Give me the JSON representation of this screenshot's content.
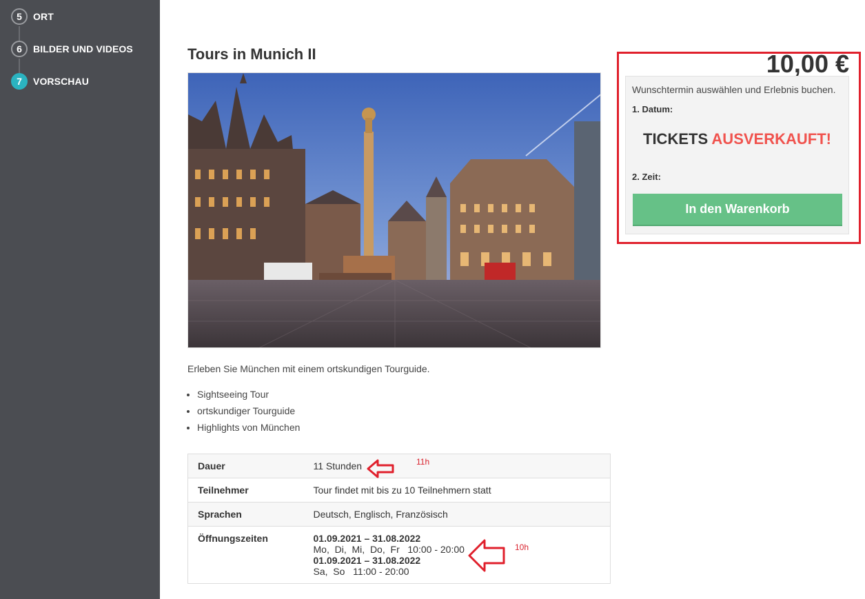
{
  "sidebar": {
    "steps": [
      {
        "number": "5",
        "label": "ORT",
        "active": false
      },
      {
        "number": "6",
        "label": "BILDER UND VIDEOS",
        "active": false
      },
      {
        "number": "7",
        "label": "VORSCHAU",
        "active": true
      }
    ]
  },
  "main": {
    "title": "Tours in Munich II",
    "description": "Erleben Sie München mit einem ortskundigen Tourguide.",
    "highlights": [
      "Sightseeing Tour",
      "ortskundiger Tourguide",
      "Highlights von München"
    ],
    "details": {
      "duration_label": "Dauer",
      "duration_value": "11 Stunden",
      "participants_label": "Teilnehmer",
      "participants_value": "Tour findet mit bis zu 10 Teilnehmern statt",
      "languages_label": "Sprachen",
      "languages_value": "Deutsch, Englisch, Französisch",
      "hours_label": "Öffnungszeiten",
      "hours": [
        {
          "range": "01.09.2021 – 31.08.2022",
          "days": "Mo,  Di,  Mi,  Do,  Fr   10:00 - 20:00"
        },
        {
          "range": "01.09.2021 – 31.08.2022",
          "days": "Sa,  So   11:00 - 20:00"
        }
      ]
    },
    "annotations": {
      "duration_note": "11h",
      "hours_note": "10h"
    }
  },
  "booking": {
    "price": "10,00 €",
    "intro": "Wunschtermin auswählen und Erlebnis buchen.",
    "date_label": "1. Datum:",
    "soldout_prefix": "TICKETS",
    "soldout_highlight": "AUSVERKAUFT!",
    "time_label": "2. Zeit:",
    "cart_button": "In den Warenkorb"
  },
  "colors": {
    "sidebar_bg": "#4b4d52",
    "active_step": "#2bb3c0",
    "cart_button": "#66c187",
    "soldout_red": "#f0524d",
    "annotation_red": "#e0202c"
  }
}
